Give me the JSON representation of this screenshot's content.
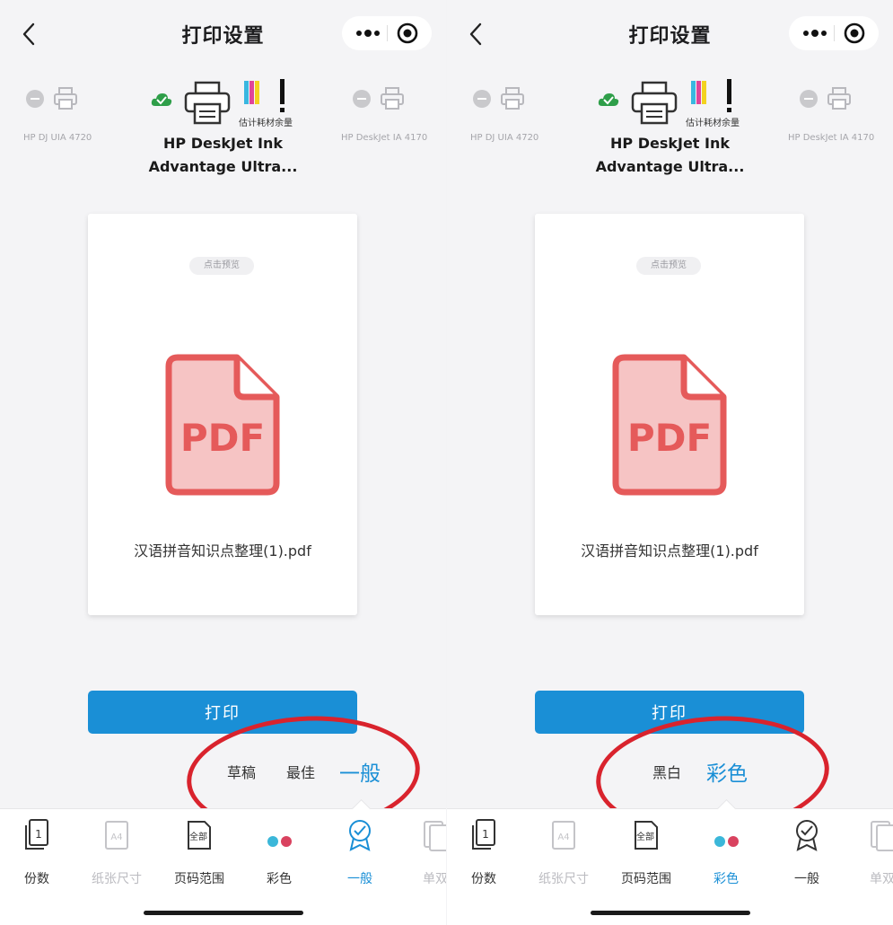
{
  "left": {
    "title": "打印设置",
    "printers": {
      "prev_name": "HP DJ UIA 4720",
      "next_name": "HP DeskJet IA 4170",
      "ink_label": "估计耗材余量",
      "selected_line1": "HP DeskJet Ink",
      "selected_line2": "Advantage Ultra..."
    },
    "preview_chip": "点击预览",
    "file_name": "汉语拼音知识点整理(1).pdf",
    "print_label": "打印",
    "options": [
      "草稿",
      "最佳",
      "一般"
    ],
    "selected_option": "一般",
    "tabs": [
      {
        "label": "份数",
        "icon": "copies-icon",
        "state": "normal"
      },
      {
        "label": "纸张尺寸",
        "icon": "paper-size-icon",
        "state": "dim"
      },
      {
        "label": "页码范围",
        "icon": "page-range-icon",
        "state": "normal"
      },
      {
        "label": "彩色",
        "icon": "color-dots-icon",
        "state": "normal"
      },
      {
        "label": "一般",
        "icon": "quality-badge-icon",
        "state": "active"
      },
      {
        "label": "单双",
        "icon": "duplex-icon",
        "state": "dim"
      }
    ]
  },
  "right": {
    "title": "打印设置",
    "printers": {
      "prev_name": "HP DJ UIA 4720",
      "next_name": "HP DeskJet IA 4170",
      "ink_label": "估计耗材余量",
      "selected_line1": "HP DeskJet Ink",
      "selected_line2": "Advantage Ultra..."
    },
    "preview_chip": "点击预览",
    "file_name": "汉语拼音知识点整理(1).pdf",
    "print_label": "打印",
    "options": [
      "黑白",
      "彩色"
    ],
    "selected_option": "彩色",
    "tabs": [
      {
        "label": "份数",
        "icon": "copies-icon",
        "state": "normal"
      },
      {
        "label": "纸张尺寸",
        "icon": "paper-size-icon",
        "state": "dim"
      },
      {
        "label": "页码范围",
        "icon": "page-range-icon",
        "state": "normal"
      },
      {
        "label": "彩色",
        "icon": "color-dots-icon",
        "state": "active"
      },
      {
        "label": "一般",
        "icon": "quality-badge-icon",
        "state": "normal"
      },
      {
        "label": "单双",
        "icon": "duplex-icon",
        "state": "dim"
      }
    ]
  },
  "icon_glyphs": {
    "copies_number": "1",
    "paper_size": "A4",
    "page_range": "全部"
  },
  "colors": {
    "accent": "#1a8fd6",
    "annotation": "#d9232d",
    "pdf": "#e55a5a",
    "ok": "#2e9e49"
  }
}
